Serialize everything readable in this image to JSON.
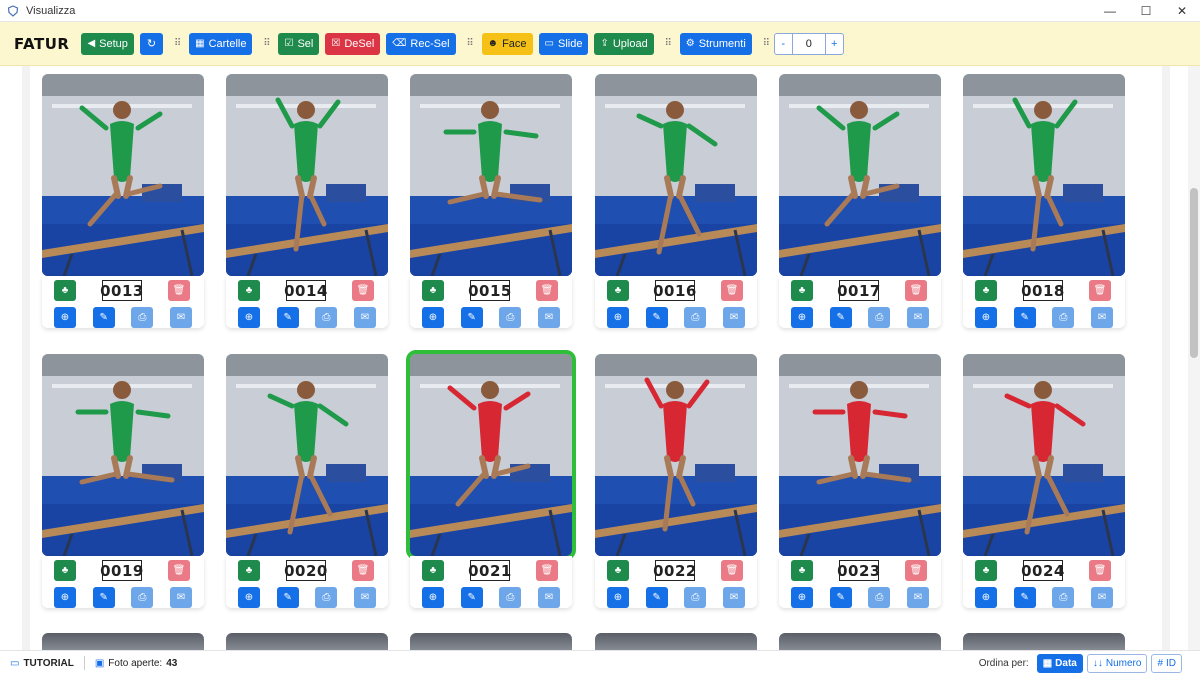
{
  "window": {
    "title": "Visualizza",
    "controls": [
      "—",
      "☐",
      "✕"
    ]
  },
  "toolbar": {
    "brand": "FATUR",
    "setup": "Setup",
    "cartelle": "Cartelle",
    "sel": "Sel",
    "desel": "DeSel",
    "recsel": "Rec-Sel",
    "face": "Face",
    "slide": "Slide",
    "upload": "Upload",
    "strumenti": "Strumenti",
    "stepper": {
      "minus": "-",
      "value": "0",
      "plus": "+"
    }
  },
  "cards": [
    {
      "number": "0013",
      "leotard": "#1f9a4a",
      "selected": false
    },
    {
      "number": "0014",
      "leotard": "#1f9a4a",
      "selected": false
    },
    {
      "number": "0015",
      "leotard": "#1f9a4a",
      "selected": false
    },
    {
      "number": "0016",
      "leotard": "#1f9a4a",
      "selected": false
    },
    {
      "number": "0017",
      "leotard": "#1f9a4a",
      "selected": false
    },
    {
      "number": "0018",
      "leotard": "#1f9a4a",
      "selected": false
    },
    {
      "number": "0019",
      "leotard": "#1f9a4a",
      "selected": false
    },
    {
      "number": "0020",
      "leotard": "#1f9a4a",
      "selected": false
    },
    {
      "number": "0021",
      "leotard": "#d62733",
      "selected": true
    },
    {
      "number": "0022",
      "leotard": "#d62733",
      "selected": false
    },
    {
      "number": "0023",
      "leotard": "#d62733",
      "selected": false
    },
    {
      "number": "0024",
      "leotard": "#d62733",
      "selected": false
    }
  ],
  "statusbar": {
    "tutorial": "TUTORIAL",
    "open_label": "Foto aperte:",
    "open_count": "43",
    "sort_label": "Ordina per:",
    "sort_data": "Data",
    "sort_numero": "Numero",
    "sort_id": "ID"
  },
  "colors": {
    "accent_blue": "#1570e8",
    "green": "#1e8a4c",
    "red": "#db3545",
    "yellow": "#f5c116",
    "toolbar_bg": "#fdf7cf",
    "selection": "#2fbe3a"
  }
}
